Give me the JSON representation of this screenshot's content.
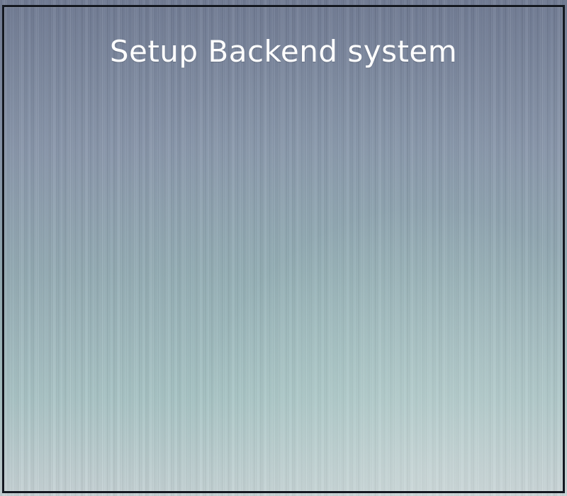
{
  "window": {
    "title": "Setup Backend system"
  },
  "colors": {
    "background_top": "#6f7a93",
    "background_bottom": "#c7d3d6",
    "border": "#141820",
    "title_text": "#ffffff"
  }
}
